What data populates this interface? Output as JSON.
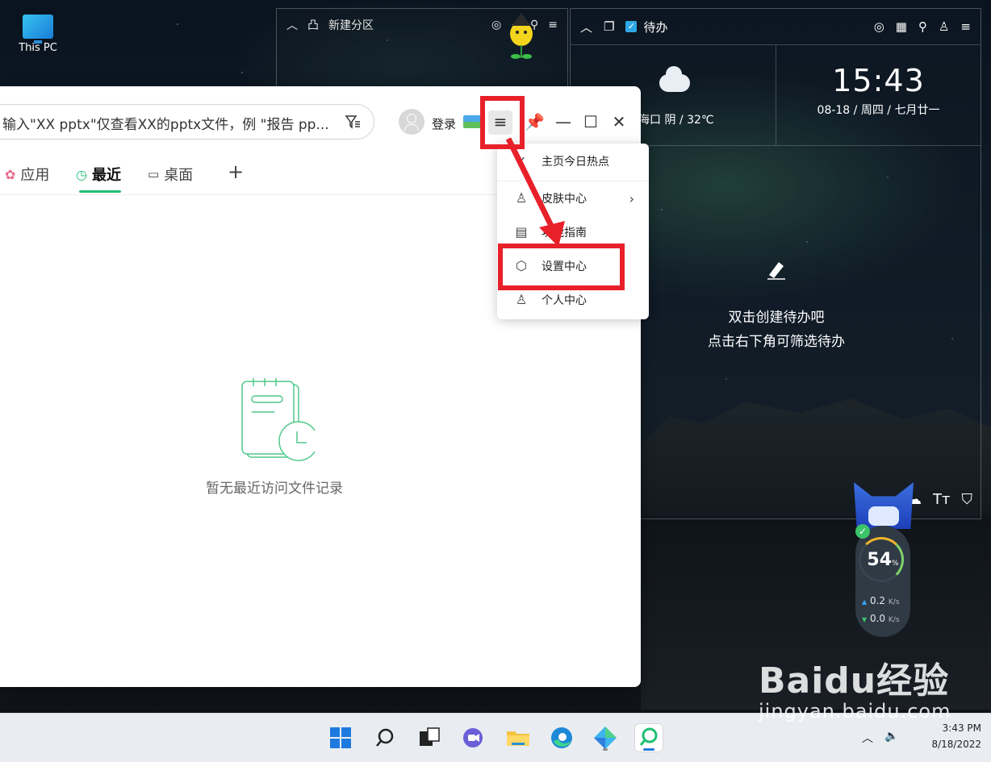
{
  "desktop": {
    "icon_label": "This PC"
  },
  "partition_widget": {
    "title": "新建分区"
  },
  "todo_widget": {
    "title": "待办",
    "weather": "海口 阴 / 32℃",
    "time": "15:43",
    "date": "08-18 / 周四 / 七月廿一",
    "empty_line1": "双击创建待办吧",
    "empty_line2": "点击右下角可筛选待办"
  },
  "speed_widget": {
    "percent": "54",
    "percent_unit": "%",
    "upload": "0.2",
    "download": "0.0",
    "unit": "K/s"
  },
  "window": {
    "search_value": "输入\"XX pptx\"仅查看XX的pptx文件，例 \"报告 pp...",
    "login_label": "登录",
    "tabs": [
      {
        "label": "应用"
      },
      {
        "label": "最近"
      },
      {
        "label": "桌面"
      }
    ],
    "add_tab": "+",
    "empty_text": "暂无最近访问文件记录"
  },
  "menu": {
    "items": [
      {
        "label": "主页今日热点",
        "checked": true
      },
      {
        "label": "皮肤中心",
        "has_submenu": true
      },
      {
        "label": "功能指南"
      },
      {
        "label": "设置中心"
      },
      {
        "label": "个人中心"
      }
    ]
  },
  "taskbar": {
    "time": "3:43 PM",
    "date": "8/18/2022"
  },
  "watermark": {
    "brand": "Baidu经验",
    "url": "jingyan.baidu.com"
  },
  "colors": {
    "accent_green": "#1fbf74",
    "highlight_red": "#e8202a",
    "todo_check": "#2fa8e6"
  }
}
